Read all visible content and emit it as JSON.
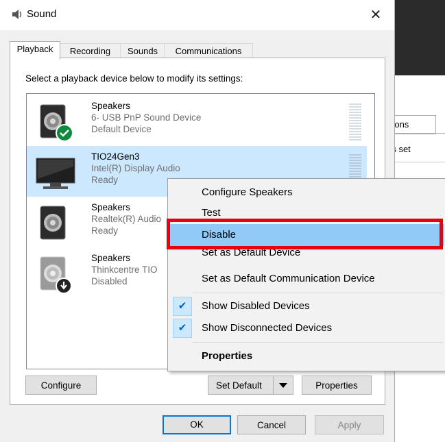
{
  "window": {
    "title": "Sound",
    "close_glyph": "✕"
  },
  "tabs": [
    {
      "label": "Playback",
      "active": true
    },
    {
      "label": "Recording",
      "active": false
    },
    {
      "label": "Sounds",
      "active": false
    },
    {
      "label": "Communications",
      "active": false
    }
  ],
  "instruction": "Select a playback device below to modify its settings:",
  "devices": [
    {
      "name": "Speakers",
      "description": "6- USB PnP Sound Device",
      "status": "Default Device",
      "icon": "speaker-icon",
      "badge": "green-check-badge"
    },
    {
      "name": "TIO24Gen3",
      "description": "Intel(R) Display Audio",
      "status": "Ready",
      "icon": "monitor-icon",
      "selected": true
    },
    {
      "name": "Speakers",
      "description": "Realtek(R) Audio",
      "status": "Ready",
      "icon": "speaker-icon"
    },
    {
      "name": "Speakers",
      "description": "Thinkcentre TIO",
      "status": "Disabled",
      "icon": "speaker-disabled-icon",
      "badge": "down-arrow-badge"
    }
  ],
  "buttons": {
    "configure": "Configure",
    "set_default": "Set Default",
    "properties": "Properties",
    "ok": "OK",
    "cancel": "Cancel",
    "apply": "Apply"
  },
  "context_menu": {
    "items": [
      {
        "label": "Configure Speakers"
      },
      {
        "label": "Test"
      },
      {
        "label": "Disable",
        "highlighted": true
      },
      {
        "label": "Set as Default Device"
      },
      {
        "label": "Set as Default Communication Device"
      },
      {
        "label": "Show Disabled Devices",
        "checked": true
      },
      {
        "label": "Show Disconnected Devices",
        "checked": true
      },
      {
        "label": "Properties",
        "bold": true
      }
    ],
    "check_glyph": "✔"
  },
  "background_window": {
    "tab_fragment": "nications",
    "text_fragment": "dify its set"
  },
  "colors": {
    "selection": "#cce8ff",
    "menu_highlight": "#91c9f7",
    "annotation_red": "#e8000e",
    "default_button_border": "#0078d7"
  }
}
